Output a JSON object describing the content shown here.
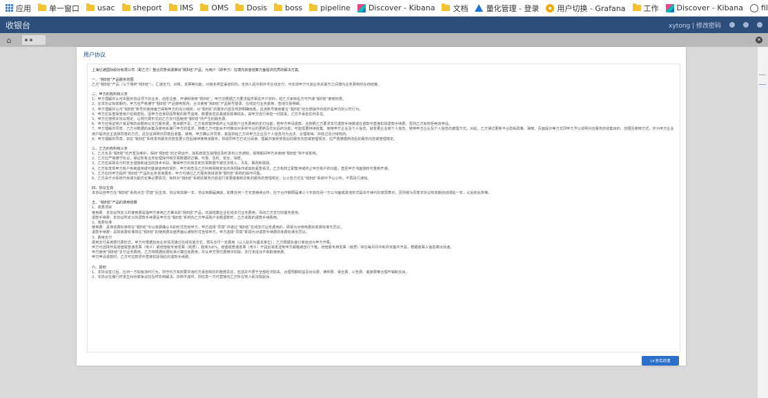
{
  "bookmarks": [
    {
      "label": "应用",
      "icon": "apps-icon"
    },
    {
      "label": "单一窗口",
      "icon": "folder-icon"
    },
    {
      "label": "usac",
      "icon": "folder-icon"
    },
    {
      "label": "sheport",
      "icon": "folder-icon"
    },
    {
      "label": "IMS",
      "icon": "folder-icon"
    },
    {
      "label": "OMS",
      "icon": "folder-icon"
    },
    {
      "label": "Dosis",
      "icon": "folder-icon"
    },
    {
      "label": "boss",
      "icon": "folder-icon"
    },
    {
      "label": "pipeline",
      "icon": "folder-icon"
    },
    {
      "label": "Discover - Kibana",
      "icon": "kibana-icon"
    },
    {
      "label": "文档",
      "icon": "folder-icon"
    },
    {
      "label": "量化管理 - 登录",
      "icon": "triangle-logo-icon"
    },
    {
      "label": "用户切换 - Grafana",
      "icon": "grafana-icon"
    },
    {
      "label": "工作",
      "icon": "folder-icon"
    },
    {
      "label": "Discover - Kibana",
      "icon": "kibana-icon"
    },
    {
      "label": "file:/D:/javaGit/ep...",
      "icon": "globe-icon"
    }
  ],
  "appbar": {
    "title": "收银台",
    "user": "xytong | 修改密码"
  },
  "modal": {
    "title": "用户协议",
    "intro": "上海亿通国际股份有限公司（即乙方）整合优势资源推出“税E结”产品，为用户（即甲方）在境内资金结算方面提供优质的解决方案。",
    "sections": [
      {
        "heading": "一、“税E结”产品服务范围",
        "lines": [
          "乙方“税E结”产品（以下简称“税E结”），汇通支付、对账、发票等功能，对接多类型渠道机构，支持人民币和外币在线支付，可实现甲方与其业务关联方之间境内业务费用的在线结算。"
        ]
      },
      {
        "heading": "二、甲方的权利和义务",
        "lines": [
          "1、甲方理解并认可本服务协议项下的业务，自愿注册、开通和使用“税E结”，甲方应根据乙方要求提供相关开户材料，经乙方审核后方可开通“税E结”使用权限。",
          "2、在本协议有效期内，甲方应严格遵守“税E结”产品使用规则，合法使用“税E结”产品账号登录、在线支付业务费用、查询交易明细。",
          "3、甲方理解并认可“税E结”账号的使用者已得到甲方的充分授权，对“税E结”的服务内容及规则明确知悉，且该账号使用者在“税E结”的全部操作均视作是甲方的公司行为。",
          "4、甲方应妥善保管用户名和密码，因甲方自身原因导致的账号盗用、数据信息失真或受损等损失，由甲方自行承担一切损失，乙方不承担任何责任。",
          "5、甲方应按照本协议规定，以预付费形式向乙方支付因使用“税E结”所产生的服务费。",
          "6、甲方应保证账户有足够的余额用以支付服务费，若余额不足，乙方有权暂停或终止为其账户业务费用的支付功能；若甲方申请退款，应按照乙方要求支付退款手续费或在退款中直接扣除退款手续费，否则乙方有权拒绝该申请。",
          "7、甲方理解并同意，乙方对数据的采集及使用系履行甲方的需求，随着乙方可能会不时推出对系统平台的更新及优化后的功能，可能需要持续收集、使用甲方企业及个人信息，就变更企业或个人信息、使用甲方企业及个人信息的披露方式。对此，乙方通过更新平台隐私政策、弹窗、页面提示等方式同甲方予以说明对应服务的收集目的、范围及使用方式，并为甲方企业用户提供自主选择同意的方式，且在征得明示同意后收集、使用。甲方确认并同意，其提供给乙方的甲方企业及个人信息均为合法、合理取得，并经过充分授权的。",
          "8、甲方理解并同意，如在“税E结”系统发布服务内容变更公告后继续使用该服务，则视同甲方已充分阅读、理解并接受修改后的服务内容或管理规定，应严格遵循修改后的服务内容或管理规定。"
        ]
      },
      {
        "heading": "三、乙方的权利和义务",
        "lines": [
          "1、乙方负责“税E结”的开发及维护，保持“税E结”的正常运作。如系统发生故障应及时发布公告通知，故障期间甲方未使用“税E结”将不受影响。",
          "2、乙方应严格遵守协议，保证所有业务处理操作和交易数据的正确、可靠、及时、安全、保密。",
          "3、乙方应采取充分的安全措施和适当的技术手段，确保甲方的信息和交易数据不被非法侵入、灭失、篡改和毁损。",
          "4、乙方如发现甲方账户有被盗用或可能被盗用的情形，甲方有危及乙方利用网络安全的违规操作或其他紧急情况，乙方有权立即暂停或终止甲方账户的功能，直至甲方书面授权可重新开通。",
          "5、乙方应向甲方提供“税E结”产品的业务咨询服务，甲方可通过乙方服务热线咨询“税E结”系统的操作问题。",
          "6、乙方由于对系统升级或功能优化等必要情况，有权对“税E结”系统的服务内容进行变更或者制定新的服务的管理规定，以公告方式在“税E结”系统中予以公布，不再另行通知。"
        ]
      },
      {
        "heading": "四、协议生效",
        "lines": [
          "本协议自甲方在“税E结”系统点击“同意”后生效，协议有效期一年，协议到期届满前，如果任何一方无意继续合作，应于合作期限届满三十天前向另一方以书面或其他形式提出不续约的意思表示，否则视为同意本协议有效期自动顺延一年，以后依此类推。"
        ]
      },
      {
        "heading": "五、“税E结”产品的费用结算",
        "lines": [
          "1、收费项目",
          "使用费：本协议所定义的使用费是指甲方使用乙方推出的“税E结”产品，向其结算企业在线支付业务费用，而向乙方支付的服务费用。",
          "退款手续费：本协议所定义的退款手续费是甲方在“税E结”系统向乙方申请账户余额退款时，乙方收取的退款手续费用。",
          "2、收费标准",
          "使用费：具体收费标准将在“税E结”中以收费确认书的形式告知甲方，甲方选择“同意”并通过“税E结”在线支付业务费用的，即视为对使用费的收费标准无异议。",
          "退款手续费：具体收费标准将在“税E结”的使用费充值界面以通知形式告知甲方，甲方选择“同意”即视为对退款手续费的收费标准无异议。",
          "3、费用支付",
          "费用支付采用预付费形式。甲方可根据自身业务情况通过在线充值方式，预先支付一定费用（以人民币为基本单位），乙方根据充值订单自动为甲方开票。",
          "甲方可选择开具增值税普通发票（电子）或增值税专用发票（纸质），税率为6%。增值税普通发票（电子）开具后将发送到甲方邮箱或自行下载，增值税专用发票（纸质）将在每月月中和月末集中开具，根据收票人信息寄出快递。",
          "甲方使用“税E结”支付业务费用，乙方将根据收费标准计算应收费用，并从甲方预付费用中扣除，支付未成功不收取使用费。",
          "甲方申请退款时，乙方可在款项中直接扣除相应的退款手续费。"
        ]
      },
      {
        "heading": "六、其他",
        "lines": [
          "1、本协议签订后，任何一方如有违约行为，则守约方有权要求违约方承担相应的赔偿责任，包括并不限于全部经济损失、合理预期收益及诉讼费、律师费、保全费、公告费、差旅费等合理开销和支出。",
          "2、本协议在履行时发生纠纷或争议应及时协商解决。协商不成时，则任意一方可直接向乙方所在地人民法院起诉。"
        ]
      }
    ],
    "agree_button": "14 秒后同意"
  },
  "colors": {
    "appbar": "#2d4d7a",
    "accent": "#2a6fc9",
    "folder": "#f2c230"
  }
}
